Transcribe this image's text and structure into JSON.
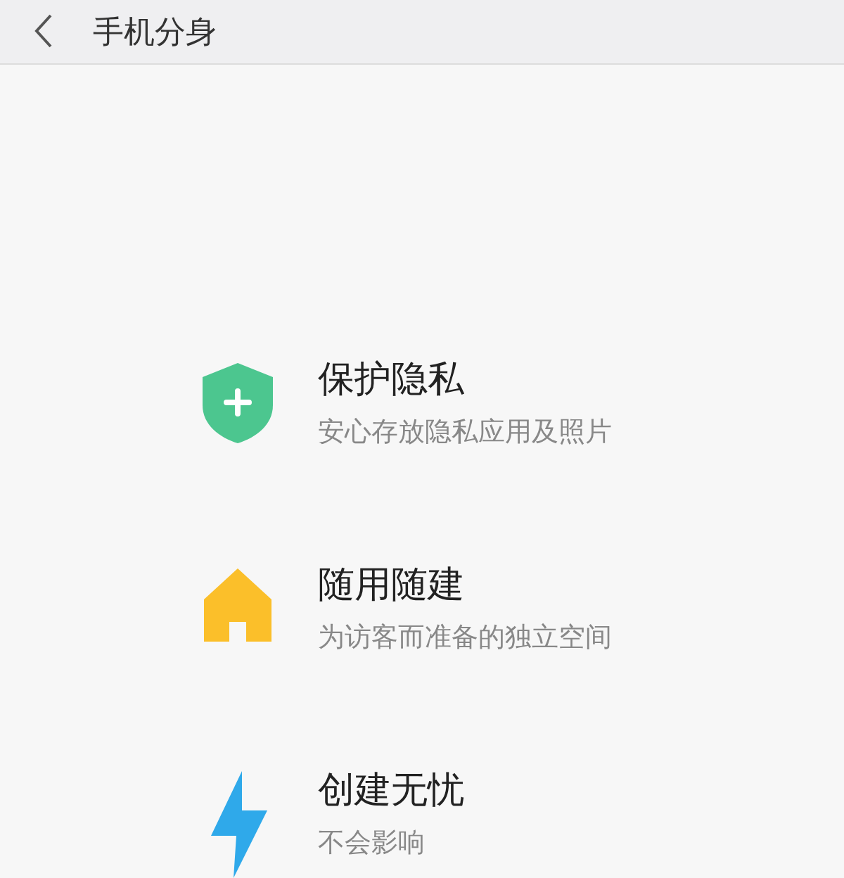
{
  "header": {
    "title": "手机分身"
  },
  "features": [
    {
      "kind": "shield",
      "title": "保护隐私",
      "description": "安心存放隐私应用及照片"
    },
    {
      "kind": "home",
      "title": "随用随建",
      "description": "为访客而准备的独立空间"
    },
    {
      "kind": "bolt",
      "title": "创建无忧",
      "description": "不会影响"
    }
  ]
}
